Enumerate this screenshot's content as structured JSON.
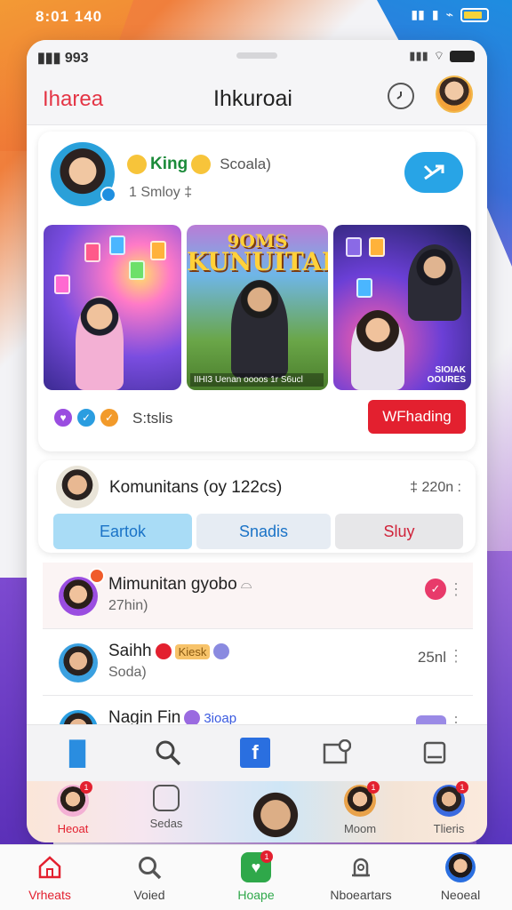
{
  "os_status": {
    "time": "8:01 140",
    "icons": [
      "signal-icon",
      "wifi-icon",
      "battery-icon"
    ]
  },
  "inner_status": {
    "time": "993"
  },
  "header": {
    "brand": "Iharea",
    "title": "Ihkuroai",
    "clock_icon": "clock-icon",
    "avatar": "user-avatar"
  },
  "story": {
    "name": "King",
    "source": "Scoala)",
    "meta": "1 Smloy ‡",
    "share_icon": "share-icon",
    "thumbnails": [
      {
        "title_1": "",
        "title_2": "",
        "caption": "",
        "corner": ""
      },
      {
        "title_1": "9OMS",
        "title_2": "KUNUITAI",
        "caption": "IIHI3 Uenan oooos 1r S6ucl",
        "corner": ""
      },
      {
        "title_1": "",
        "title_2": "",
        "caption": "",
        "corner": "SIOIAK\nOOURES"
      }
    ],
    "reaction_count": "S:tslis",
    "watch_label": "WFhading"
  },
  "community": {
    "title": "Komunitans (oy 122cs)",
    "count": "‡ 220n :",
    "tabs": [
      "Eartok",
      "Snadis",
      "Sluy"
    ]
  },
  "list": [
    {
      "name": "Mimunitan gyobo",
      "sub": "27hin)",
      "right": "",
      "tag": ""
    },
    {
      "name": "Saihh",
      "sub": "Soda)",
      "right": "25nl",
      "tag": "Kiesk"
    },
    {
      "name": "Nagin Fin",
      "sub": "",
      "right": "",
      "tag": "3ioap"
    }
  ],
  "stories": [
    {
      "label": "Heoat"
    },
    {
      "label": "Sedas"
    },
    {
      "label": ""
    },
    {
      "label": "Moom"
    },
    {
      "label": "Tlieris"
    }
  ],
  "bottom_nav": [
    {
      "label": "Vrheats",
      "icon": "home-icon"
    },
    {
      "label": "Voied",
      "icon": "search-icon"
    },
    {
      "label": "Hoape",
      "icon": "chat-icon"
    },
    {
      "label": "Nboeartars",
      "icon": "alarm-icon"
    },
    {
      "label": "Neoeal",
      "icon": "profile-icon"
    }
  ],
  "colors": {
    "accent": "#e3202f",
    "blue": "#28a4e6",
    "green": "#1c8b3a"
  }
}
